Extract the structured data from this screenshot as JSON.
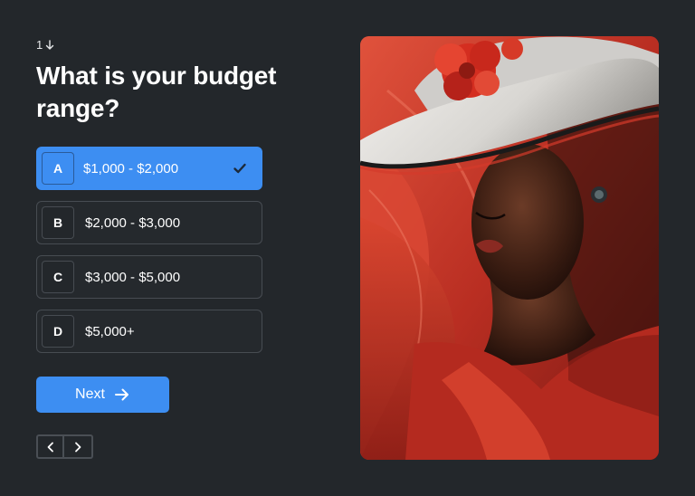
{
  "question": {
    "number": "1",
    "title": "What is your budget range?"
  },
  "options": [
    {
      "key": "A",
      "label": "$1,000 - $2,000",
      "selected": true
    },
    {
      "key": "B",
      "label": "$2,000 - $3,000",
      "selected": false
    },
    {
      "key": "C",
      "label": "$3,000 - $5,000",
      "selected": false
    },
    {
      "key": "D",
      "label": "$5,000+",
      "selected": false
    }
  ],
  "next_button": {
    "label": "Next"
  },
  "colors": {
    "accent": "#3d8ef2",
    "background": "#23272b",
    "border": "#474c52"
  },
  "icons": {
    "question_number": "arrow-down-icon",
    "selected": "checkmark-icon",
    "next": "arrow-right-icon",
    "prev_page": "chevron-left-icon",
    "next_page": "chevron-right-icon"
  },
  "image": {
    "subject": "woman in wide-brimmed hat with red flower, red flowing fabric"
  }
}
